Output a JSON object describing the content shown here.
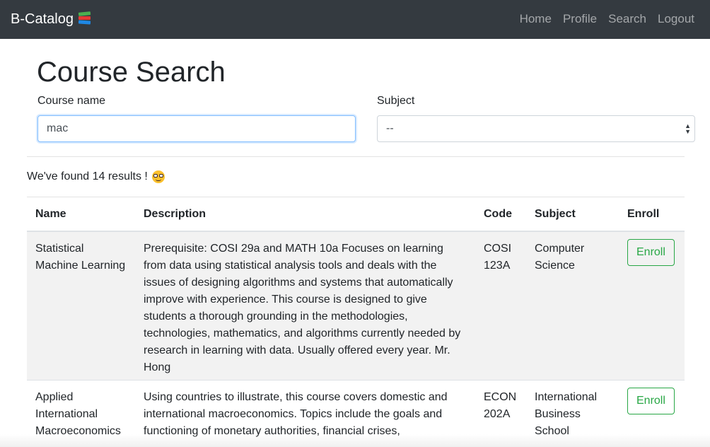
{
  "navbar": {
    "brand": "B-Catalog",
    "brand_icon": "books-icon",
    "links": [
      "Home",
      "Profile",
      "Search",
      "Logout"
    ]
  },
  "page": {
    "title": "Course Search"
  },
  "search": {
    "course_label": "Course name",
    "course_value": "mac",
    "subject_label": "Subject",
    "subject_selected": "--"
  },
  "results": {
    "text": "We've found 14 results !",
    "icon": "nerd-face-icon"
  },
  "table": {
    "headers": [
      "Name",
      "Description",
      "Code",
      "Subject",
      "Enroll"
    ],
    "rows": [
      {
        "name": "Statistical Machine Learning",
        "description": "Prerequisite: COSI 29a and MATH 10a Focuses on learning from data using statistical analysis tools and deals with the issues of designing algorithms and systems that automatically improve with experience. This course is designed to give students a thorough grounding in the methodologies, technologies, mathematics, and algorithms currently needed by research in learning with data. Usually offered every year. Mr. Hong",
        "code": "COSI 123A",
        "subject": "Computer Science",
        "enroll": "Enroll"
      },
      {
        "name": "Applied International Macroeconomics",
        "description": "Using countries to illustrate, this course covers domestic and international macroeconomics. Topics include the goals and functioning of monetary authorities, financial crises,",
        "code": "ECON 202A",
        "subject": "International Business School",
        "enroll": "Enroll"
      }
    ]
  },
  "colors": {
    "navbar_bg": "#343a40",
    "enroll_green": "#28a745",
    "stripe": "#f2f2f2"
  }
}
